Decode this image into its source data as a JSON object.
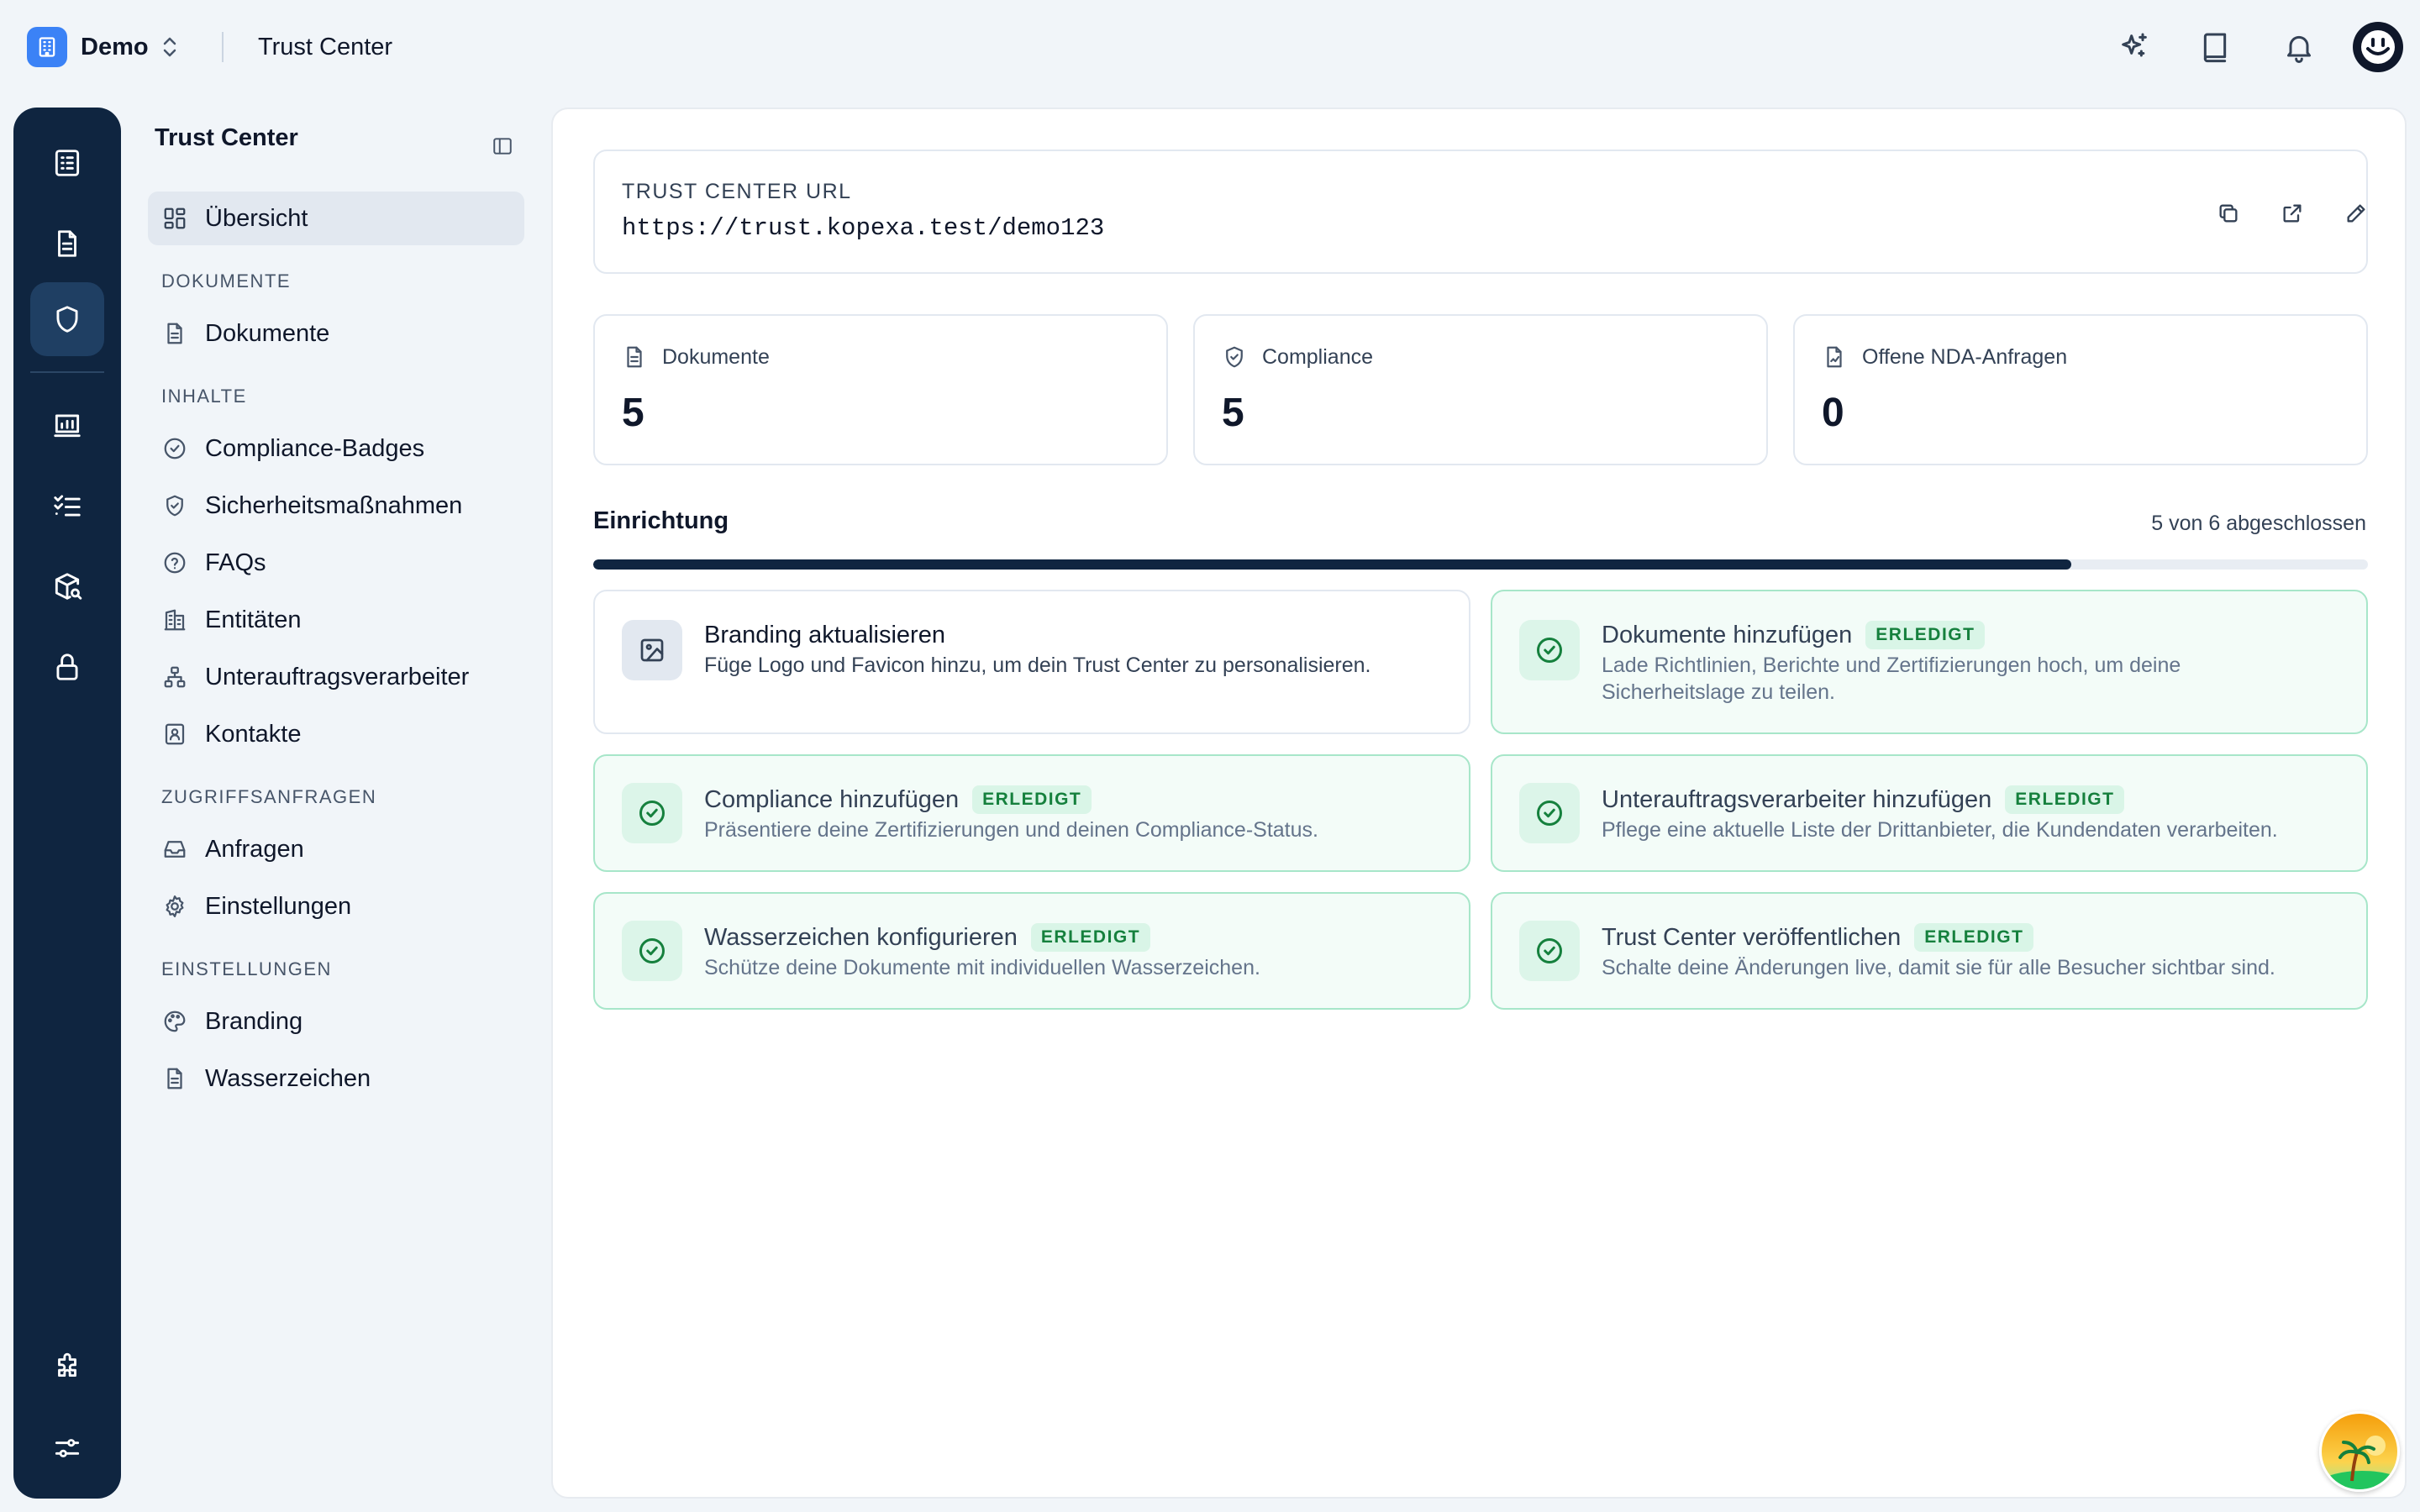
{
  "topbar": {
    "workspace_name": "Demo",
    "title": "Trust Center",
    "icons": [
      "sparkles-icon",
      "book-icon",
      "bell-icon",
      "user-avatar"
    ]
  },
  "rail": {
    "items": [
      "checklist-icon",
      "document-icon",
      "shield-icon",
      "chart-icon",
      "tasks-icon",
      "package-search-icon",
      "lock-icon",
      "puzzle-icon",
      "sliders-icon"
    ],
    "active": "shield-icon"
  },
  "sidebar": {
    "title": "Trust Center",
    "overview": "Übersicht",
    "sections": {
      "documents": "DOKUMENTE",
      "contents": "INHALTE",
      "access": "ZUGRIFFSANFRAGEN",
      "settings": "EINSTELLUNGEN"
    },
    "items": {
      "documents": "Dokumente",
      "badges": "Compliance-Badges",
      "measures": "Sicherheitsmaßnahmen",
      "faqs": "FAQs",
      "entities": "Entitäten",
      "subprocessors": "Unterauftragsverarbeiter",
      "contacts": "Kontakte",
      "requests": "Anfragen",
      "access_settings": "Einstellungen",
      "branding": "Branding",
      "watermark": "Wasserzeichen"
    }
  },
  "url_card": {
    "label": "TRUST CENTER URL",
    "value": "https://trust.kopexa.test/demo123"
  },
  "stats": [
    {
      "label": "Dokumente",
      "value": "5",
      "icon": "document-icon"
    },
    {
      "label": "Compliance",
      "value": "5",
      "icon": "shield-check-icon"
    },
    {
      "label": "Offene NDA-Anfragen",
      "value": "0",
      "icon": "file-signature-icon"
    }
  ],
  "setup": {
    "title": "Einrichtung",
    "progress_text": "5 von 6 abgeschlossen",
    "progress": 0.833,
    "done_label": "ERLEDIGT",
    "tasks": [
      {
        "title": "Branding aktualisieren",
        "desc": "Füge Logo und Favicon hinzu, um dein Trust Center zu personalisieren.",
        "done": false
      },
      {
        "title": "Dokumente hinzufügen",
        "desc": "Lade Richtlinien, Berichte und Zertifizierungen hoch, um deine Sicherheitslage zu teilen.",
        "done": true
      },
      {
        "title": "Compliance hinzufügen",
        "desc": "Präsentiere deine Zertifizierungen und deinen Compliance-Status.",
        "done": true
      },
      {
        "title": "Unterauftragsverarbeiter hinzufügen",
        "desc": "Pflege eine aktuelle Liste der Drittanbieter, die Kundendaten verarbeiten.",
        "done": true
      },
      {
        "title": "Wasserzeichen konfigurieren",
        "desc": "Schütze deine Dokumente mit individuellen Wasserzeichen.",
        "done": true
      },
      {
        "title": "Trust Center veröffentlichen",
        "desc": "Schalte deine Änderungen live, damit sie für alle Besucher sichtbar sind.",
        "done": true
      }
    ]
  },
  "colors": {
    "rail": "#0f2540",
    "accent": "#3b82f6",
    "done_border": "#a7e6c9",
    "done_badge": "#15803d"
  }
}
